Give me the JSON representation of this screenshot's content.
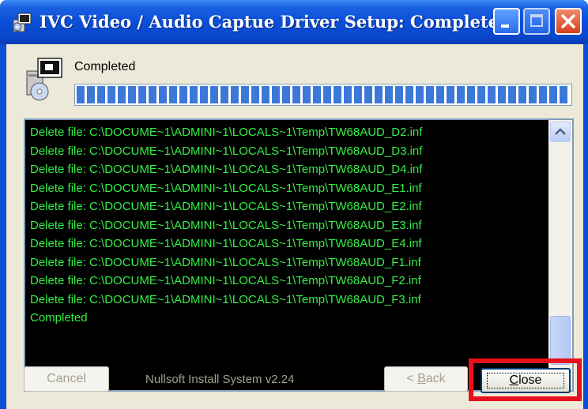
{
  "window": {
    "title": "IVC Video / Audio Captue Driver Setup: Completed",
    "colors": {
      "titlebar": "#0b4ed8",
      "client": "#ece9d8",
      "log_text": "#33ee44",
      "highlight": "#e8101b"
    }
  },
  "status": {
    "label": "Completed",
    "progress_fraction": 1.0
  },
  "log": {
    "lines": [
      "Delete file: C:\\DOCUME~1\\ADMINI~1\\LOCALS~1\\Temp\\TW68AUD_D2.inf",
      "Delete file: C:\\DOCUME~1\\ADMINI~1\\LOCALS~1\\Temp\\TW68AUD_D3.inf",
      "Delete file: C:\\DOCUME~1\\ADMINI~1\\LOCALS~1\\Temp\\TW68AUD_D4.inf",
      "Delete file: C:\\DOCUME~1\\ADMINI~1\\LOCALS~1\\Temp\\TW68AUD_E1.inf",
      "Delete file: C:\\DOCUME~1\\ADMINI~1\\LOCALS~1\\Temp\\TW68AUD_E2.inf",
      "Delete file: C:\\DOCUME~1\\ADMINI~1\\LOCALS~1\\Temp\\TW68AUD_E3.inf",
      "Delete file: C:\\DOCUME~1\\ADMINI~1\\LOCALS~1\\Temp\\TW68AUD_E4.inf",
      "Delete file: C:\\DOCUME~1\\ADMINI~1\\LOCALS~1\\Temp\\TW68AUD_F1.inf",
      "Delete file: C:\\DOCUME~1\\ADMINI~1\\LOCALS~1\\Temp\\TW68AUD_F2.inf",
      "Delete file: C:\\DOCUME~1\\ADMINI~1\\LOCALS~1\\Temp\\TW68AUD_F3.inf",
      "Completed"
    ]
  },
  "footer": {
    "cancel_label": "Cancel",
    "branding": "Nullsoft Install System v2.24",
    "back_prefix": "< ",
    "back_mnemonic": "B",
    "back_rest": "ack",
    "close_mnemonic": "C",
    "close_rest": "lose"
  },
  "icons": {
    "title": "installer-icon",
    "header": "setup-disc-icon",
    "minimize": "minimize-icon",
    "maximize": "maximize-icon",
    "close": "close-x-icon"
  }
}
